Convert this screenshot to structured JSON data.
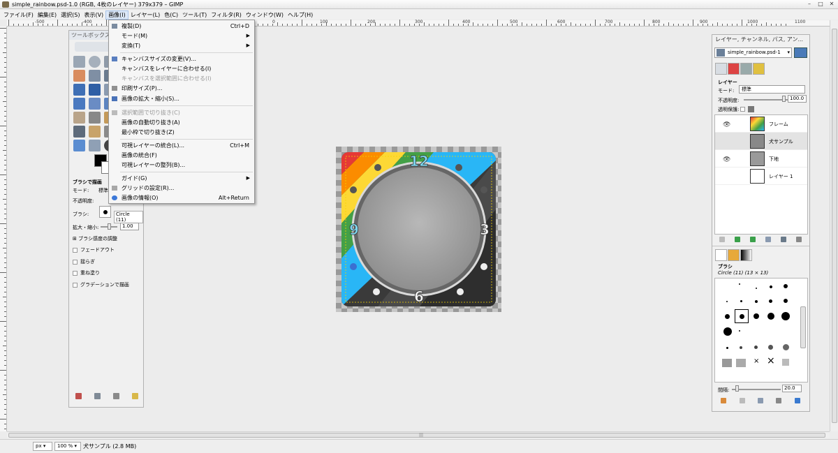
{
  "window": {
    "title": "simple_rainbow.psd-1.0 (RGB, 4枚のレイヤー) 379x379 – GIMP",
    "controls": [
      "–",
      "□",
      "✕"
    ]
  },
  "menubar": [
    "ファイル(F)",
    "編集(E)",
    "選択(S)",
    "表示(V)",
    "画像(I)",
    "レイヤー(L)",
    "色(C)",
    "ツール(T)",
    "フィルタ(R)",
    "ウィンドウ(W)",
    "ヘルプ(H)"
  ],
  "ruler": {
    "h_labels": [
      "-500",
      "-400",
      "-300",
      "-200",
      "-100",
      "0",
      "100",
      "200",
      "300",
      "400",
      "500",
      "600",
      "700",
      "800",
      "900",
      "1000",
      "1100",
      "1200"
    ],
    "v_labels": [
      "0",
      "100",
      "200",
      "300",
      "400",
      "500"
    ]
  },
  "image_menu": {
    "items": [
      {
        "label": "複製(D)",
        "accel": "Ctrl+D",
        "icon": "duplicate-icon"
      },
      {
        "label": "モード(M)",
        "submenu": true
      },
      {
        "label": "変換(T)",
        "submenu": true
      },
      {
        "label": "キャンバスサイズの変更(V)...",
        "icon": "canvas-size-icon"
      },
      {
        "label": "キャンバスをレイヤーに合わせる(I)"
      },
      {
        "label": "キャンバスを選択範囲に合わせる(I)",
        "disabled": true
      },
      {
        "label": "印刷サイズ(P)...",
        "icon": "print-size-icon"
      },
      {
        "label": "画像の拡大・縮小(S)...",
        "icon": "scale-icon"
      },
      {
        "label": "選択範囲で切り抜き(C)",
        "disabled": true,
        "icon": "crop-icon"
      },
      {
        "label": "画像の自動切り抜き(A)"
      },
      {
        "label": "最小枠で切り抜き(Z)"
      },
      {
        "label": "可視レイヤーの統合(L)...",
        "accel": "Ctrl+M"
      },
      {
        "label": "画像の統合(F)"
      },
      {
        "label": "可視レイヤーの整列(B)..."
      },
      {
        "label": "ガイド(G)",
        "submenu": true
      },
      {
        "label": "グリッドの設定(R)...",
        "icon": "grid-icon"
      },
      {
        "label": "画像の情報(O)",
        "accel": "Alt+Return",
        "icon": "info-icon"
      }
    ]
  },
  "toolbox": {
    "title": "ツールボックス",
    "options_title": "ブラシで描画",
    "mode_label": "モード:",
    "mode_value": "標準",
    "opacity_label": "不透明度:",
    "brush_label": "ブラシ:",
    "brush_value": "Circle (11)",
    "scale_label": "拡大・縮小:",
    "scale_value": "1.00",
    "dynamics_label": "ブラシ感度の調整",
    "checkboxes": [
      "フェードアウト",
      "揺らぎ",
      "重ね塗り",
      "グラデーションで描画"
    ]
  },
  "layers_dock": {
    "title": "レイヤー, チャンネル, パス, アン...",
    "image_select": "simple_rainbow.psd-1",
    "layers_header": "レイヤー",
    "mode_label": "モード:",
    "mode_value": "標準",
    "opacity_label": "不透明度:",
    "opacity_value": "100.0",
    "lock_label": "透明保護:",
    "layers": [
      {
        "name": "フレーム",
        "visible": true
      },
      {
        "name": "犬サンプル",
        "visible": false
      },
      {
        "name": "下地",
        "visible": true
      },
      {
        "name": "レイヤー 1",
        "visible": false
      }
    ]
  },
  "brushes_dock": {
    "header": "ブラシ",
    "selected": "Circle (11) (13 × 13)",
    "spacing_label": "間隔:",
    "spacing_value": "20.0"
  },
  "canvas_clock": {
    "numerals": [
      "12",
      "3",
      "6",
      "9"
    ]
  },
  "statusbar": {
    "unit": "px",
    "zoom": "100 %",
    "info": "犬サンプル (2.8 MB)"
  }
}
